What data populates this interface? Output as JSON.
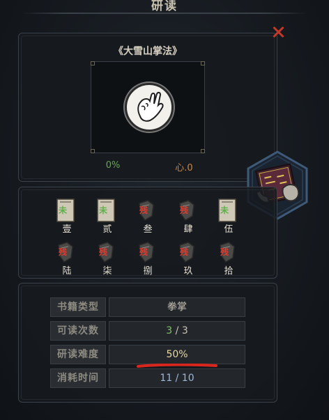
{
  "header": {
    "title": "研读"
  },
  "book": {
    "name": "《大雪山掌法》",
    "progress": "0%",
    "heart": "心.0"
  },
  "pages_row1": [
    {
      "num": "壹",
      "status": "未"
    },
    {
      "num": "贰",
      "status": "未"
    },
    {
      "num": "叁",
      "status": "残"
    },
    {
      "num": "肆",
      "status": "残"
    },
    {
      "num": "伍",
      "status": "未"
    }
  ],
  "pages_row2": [
    {
      "num": "陆",
      "status": "残"
    },
    {
      "num": "柒",
      "status": "残"
    },
    {
      "num": "捌",
      "status": "残"
    },
    {
      "num": "玖",
      "status": "残"
    },
    {
      "num": "拾",
      "status": "残"
    }
  ],
  "info": {
    "type_label": "书籍类型",
    "type_value": "拳掌",
    "reads_label": "可读次数",
    "reads_current": "3",
    "reads_sep": " / ",
    "reads_total": "3",
    "difficulty_label": "研读难度",
    "difficulty_value": "50%",
    "time_label": "消耗时间",
    "time_value": "11 / 10"
  },
  "colors": {
    "unread": "#5fb04a",
    "broken": "#e03a2e",
    "accent_red": "#c0392b"
  },
  "icons": {
    "close": "close-icon",
    "technique": "palm-technique-icon",
    "book": "book-in-hand-icon"
  }
}
